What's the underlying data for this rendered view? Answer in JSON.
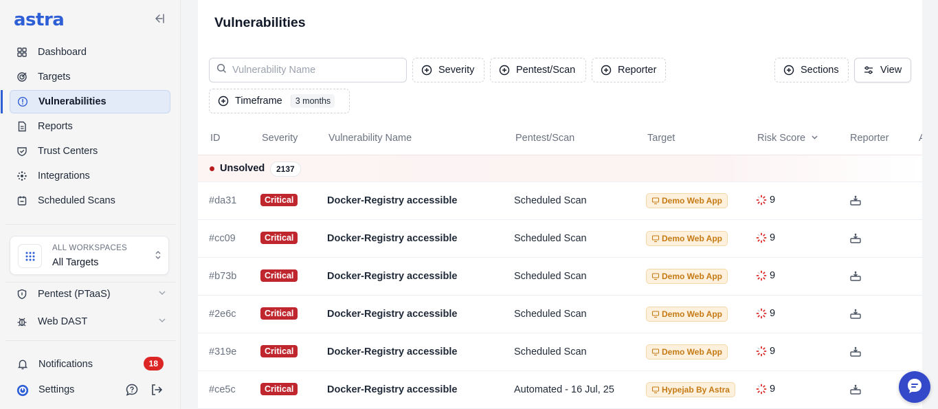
{
  "app": {
    "logo": "astra"
  },
  "sidebar": {
    "items": [
      {
        "label": "Dashboard",
        "icon": "grid-icon"
      },
      {
        "label": "Targets",
        "icon": "target-icon"
      },
      {
        "label": "Vulnerabilities",
        "icon": "alert-circle-icon",
        "active": true
      },
      {
        "label": "Reports",
        "icon": "document-icon"
      },
      {
        "label": "Trust Centers",
        "icon": "shield-check-icon"
      },
      {
        "label": "Integrations",
        "icon": "integrations-icon"
      },
      {
        "label": "Scheduled Scans",
        "icon": "calendar-icon"
      }
    ],
    "workspace": {
      "label": "ALL WORKSPACES",
      "value": "All Targets"
    },
    "groups": [
      {
        "label": "Pentest (PTaaS)",
        "icon": "shield-icon"
      },
      {
        "label": "Web DAST",
        "icon": "bug-icon"
      }
    ],
    "notifications": {
      "label": "Notifications",
      "count": "18"
    },
    "settings": {
      "label": "Settings"
    }
  },
  "main": {
    "title": "Vulnerabilities",
    "search": {
      "placeholder": "Vulnerability Name"
    },
    "filters": {
      "severity": "Severity",
      "pentest_scan": "Pentest/Scan",
      "reporter": "Reporter",
      "sections": "Sections",
      "view": "View",
      "timeframe": "Timeframe",
      "timeframe_value": "3 months"
    },
    "columns": [
      "ID",
      "Severity",
      "Vulnerability Name",
      "Pentest/Scan",
      "Target",
      "Risk Score",
      "Reporter",
      "A"
    ],
    "group": {
      "label": "Unsolved",
      "count": "2137"
    },
    "rows": [
      {
        "id": "#da31",
        "severity": "Critical",
        "name": "Docker-Registry accessible",
        "scan": "Scheduled Scan",
        "target": "Demo Web App",
        "risk": "9"
      },
      {
        "id": "#cc09",
        "severity": "Critical",
        "name": "Docker-Registry accessible",
        "scan": "Scheduled Scan",
        "target": "Demo Web App",
        "risk": "9"
      },
      {
        "id": "#b73b",
        "severity": "Critical",
        "name": "Docker-Registry accessible",
        "scan": "Scheduled Scan",
        "target": "Demo Web App",
        "risk": "9"
      },
      {
        "id": "#2e6c",
        "severity": "Critical",
        "name": "Docker-Registry accessible",
        "scan": "Scheduled Scan",
        "target": "Demo Web App",
        "risk": "9"
      },
      {
        "id": "#319e",
        "severity": "Critical",
        "name": "Docker-Registry accessible",
        "scan": "Scheduled Scan",
        "target": "Demo Web App",
        "risk": "9"
      },
      {
        "id": "#ce5c",
        "severity": "Critical",
        "name": "Docker-Registry accessible",
        "scan": "Automated - 16 Jul, 25",
        "target": "Hypejab By Astra",
        "risk": "9"
      }
    ]
  },
  "colors": {
    "brand": "#2f5fd6",
    "critical": "#c0262d",
    "target_pill": "#fdf0dc",
    "notif": "#dc2626",
    "fab": "#3349c9"
  }
}
